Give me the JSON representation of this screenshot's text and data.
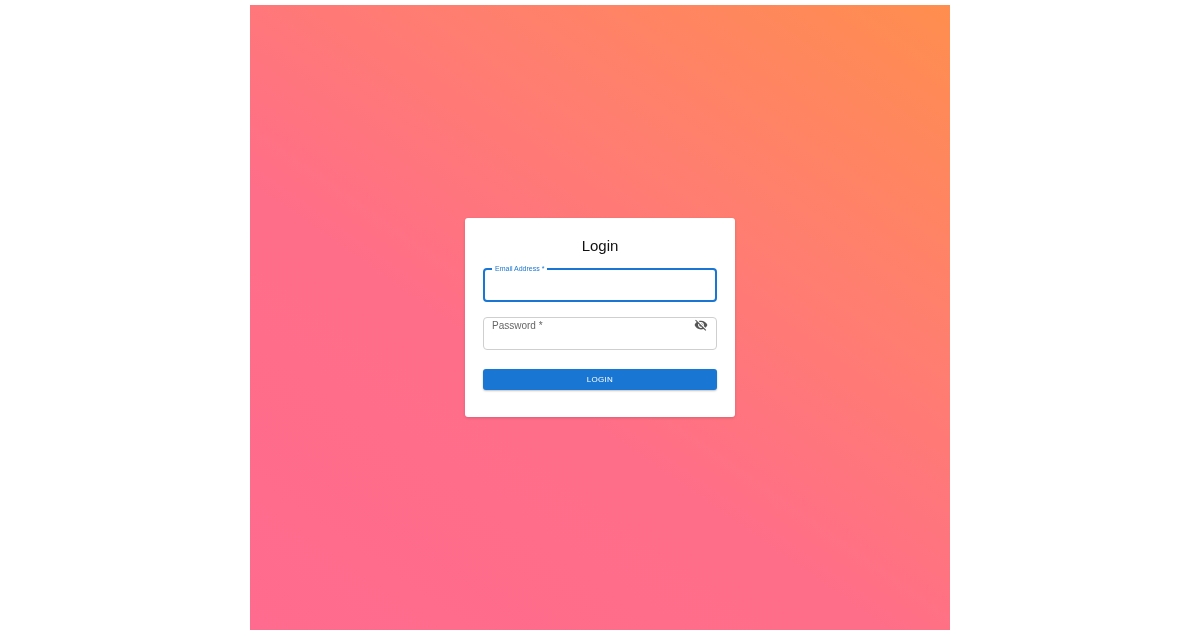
{
  "title": "Login",
  "fields": [
    {
      "kind": "email",
      "label": "Email Address *",
      "focused": true
    },
    {
      "kind": "password",
      "label": "Password *",
      "focused": false
    }
  ],
  "button": "LOGIN"
}
